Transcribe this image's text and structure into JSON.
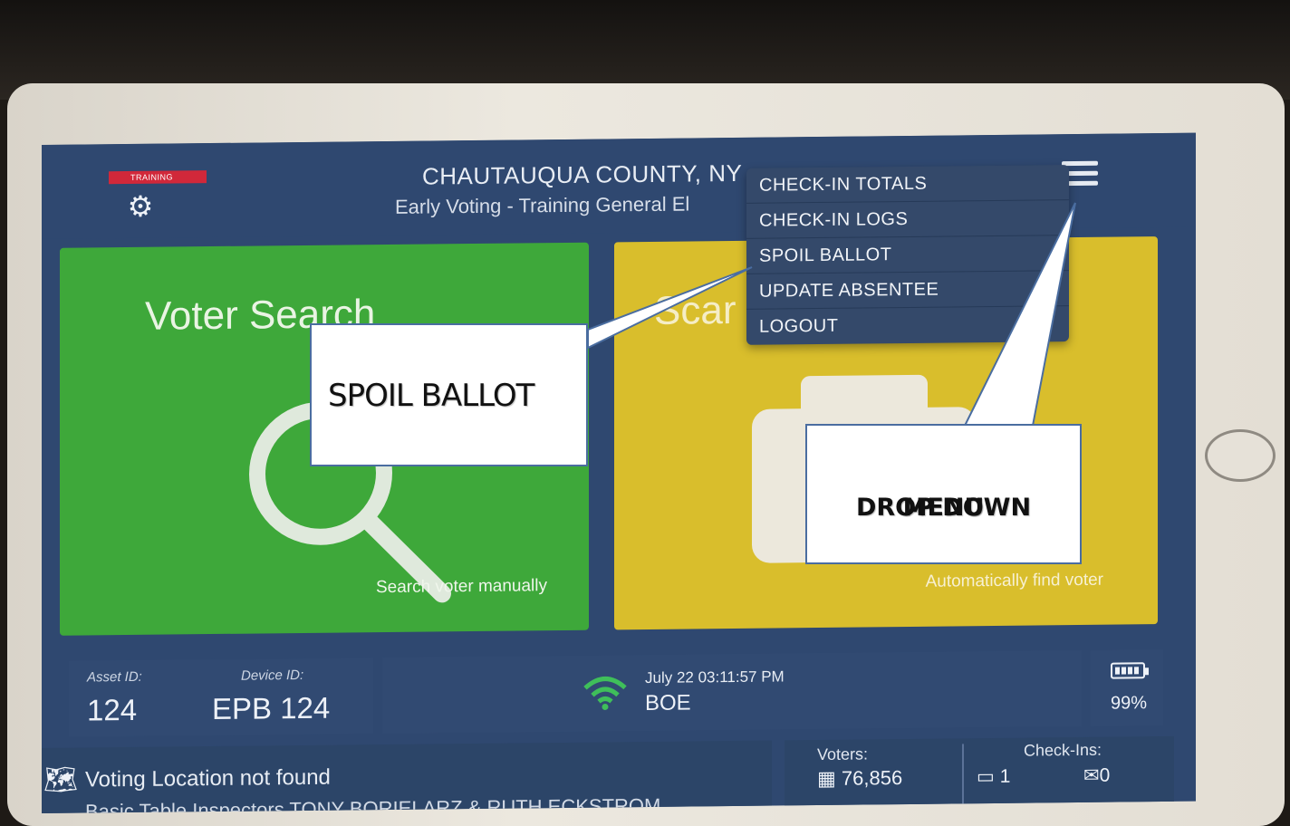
{
  "header": {
    "training_badge": "TRAINING",
    "county_title": "CHAUTAUQUA COUNTY, NY",
    "election_title": "Early Voting - Training General El"
  },
  "menu": {
    "items": [
      {
        "label": "CHECK-IN TOTALS"
      },
      {
        "label": "CHECK-IN LOGS"
      },
      {
        "label": "SPOIL BALLOT"
      },
      {
        "label": "UPDATE ABSENTEE"
      },
      {
        "label": "LOGOUT"
      }
    ]
  },
  "tiles": {
    "voter_search": {
      "title": "Voter Search",
      "subtitle": "Search voter manually",
      "color": "#3ea83a"
    },
    "scan": {
      "title": "Scar",
      "subtitle": "Automatically find voter",
      "color": "#d9be2c"
    }
  },
  "status": {
    "asset_label": "Asset ID:",
    "asset_value": "124",
    "device_label": "Device ID:",
    "device_value": "EPB 124",
    "datetime": "July 22  03:11:57 PM",
    "location_code": "BOE",
    "battery": "99%"
  },
  "bottom": {
    "location_text": "Voting Location not found",
    "inspectors_text": "Basic Table Inspectors TONY BORIELARZ & RUTH ECKSTROM",
    "voters_label": "Voters:",
    "voters_value": "76,856",
    "checkins_label": "Check-Ins:",
    "checkins_in_person": "1",
    "checkins_absentee": "0"
  },
  "callouts": {
    "spoil": "SPOIL BALLOT",
    "menu_line1": "DROP DOWN",
    "menu_line2": "MENU"
  },
  "icons": {
    "settings": "gear-icon",
    "menu": "hamburger-icon",
    "search": "magnifier-icon",
    "scan": "camera-icon",
    "signal": "wifi-icon",
    "power": "battery-icon",
    "location": "map-icon"
  },
  "colors": {
    "header_bg": "#2f4870",
    "training_red": "#d1283a",
    "wifi_green": "#3fbf5a"
  }
}
